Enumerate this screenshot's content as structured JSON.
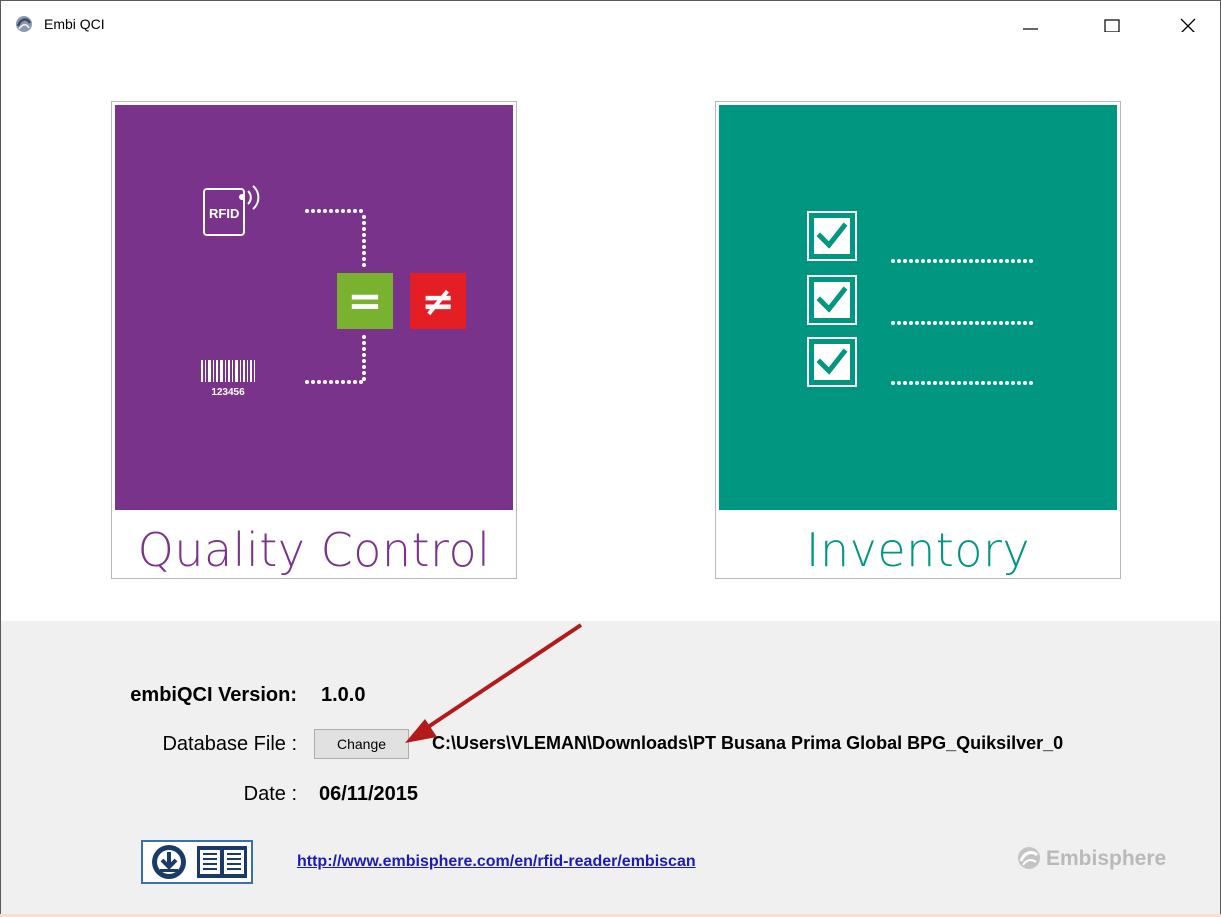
{
  "window": {
    "title": "Embi QCI",
    "controls": [
      "minimize",
      "maximize",
      "close"
    ]
  },
  "tiles": [
    {
      "label": "Quality Control",
      "color": "#7a338a",
      "art": {
        "rfid_text": "RFID",
        "barcode_number": "123456",
        "equal_symbol": "=",
        "not_equal_symbol": "≠",
        "equal_color": "#78b22e",
        "not_equal_color": "#e31e24"
      }
    },
    {
      "label": "Inventory",
      "color": "#009680"
    }
  ],
  "info": {
    "version_label": "embiQCI Version:",
    "version_value": "1.0.0",
    "database_label": "Database File :",
    "change_button": "Change",
    "database_path": "C:\\Users\\VLEMAN\\Downloads\\PT Busana Prima Global BPG_Quiksilver_0",
    "date_label": "Date :",
    "date_value": "06/11/2015"
  },
  "footer": {
    "url": "http://www.embisphere.com/en/rfid-reader/embiscan",
    "brand": "Embisphere"
  },
  "annotation": {
    "arrow_color": "#b31b1b"
  }
}
